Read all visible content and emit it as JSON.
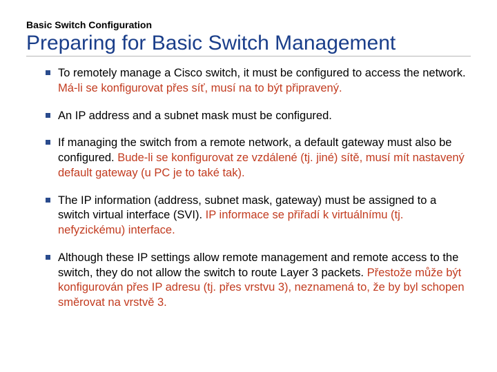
{
  "eyebrow": "Basic Switch Configuration",
  "title": "Preparing for Basic Switch Management",
  "bullets": [
    {
      "en": "To remotely manage a Cisco switch, it must be configured to access the network. ",
      "cz": "Má-li se konfigurovat přes síť, musí na to být připravený."
    },
    {
      "en": "An IP address and a subnet mask must be configured.",
      "cz": ""
    },
    {
      "en": "If managing the switch from a remote network, a default gateway must also be configured. ",
      "cz": "Bude-li se konfigurovat ze vzdálené (tj. jiné) sítě, musí mít nastavený default gateway (u PC je to také tak)."
    },
    {
      "en": "The IP information (address, subnet mask, gateway) must be assigned to a switch virtual interface (SVI). ",
      "cz": "IP informace se přiřadí k virtuálnímu (tj. nefyzickému) interface."
    },
    {
      "en": "Although these IP settings allow remote management and remote access to the switch, they do not allow the switch to route Layer 3 packets. ",
      "cz": "Přestože může být konfigurován přes IP adresu (tj. přes vrstvu 3), neznamená to, že by byl schopen směrovat na vrstvě 3."
    }
  ]
}
